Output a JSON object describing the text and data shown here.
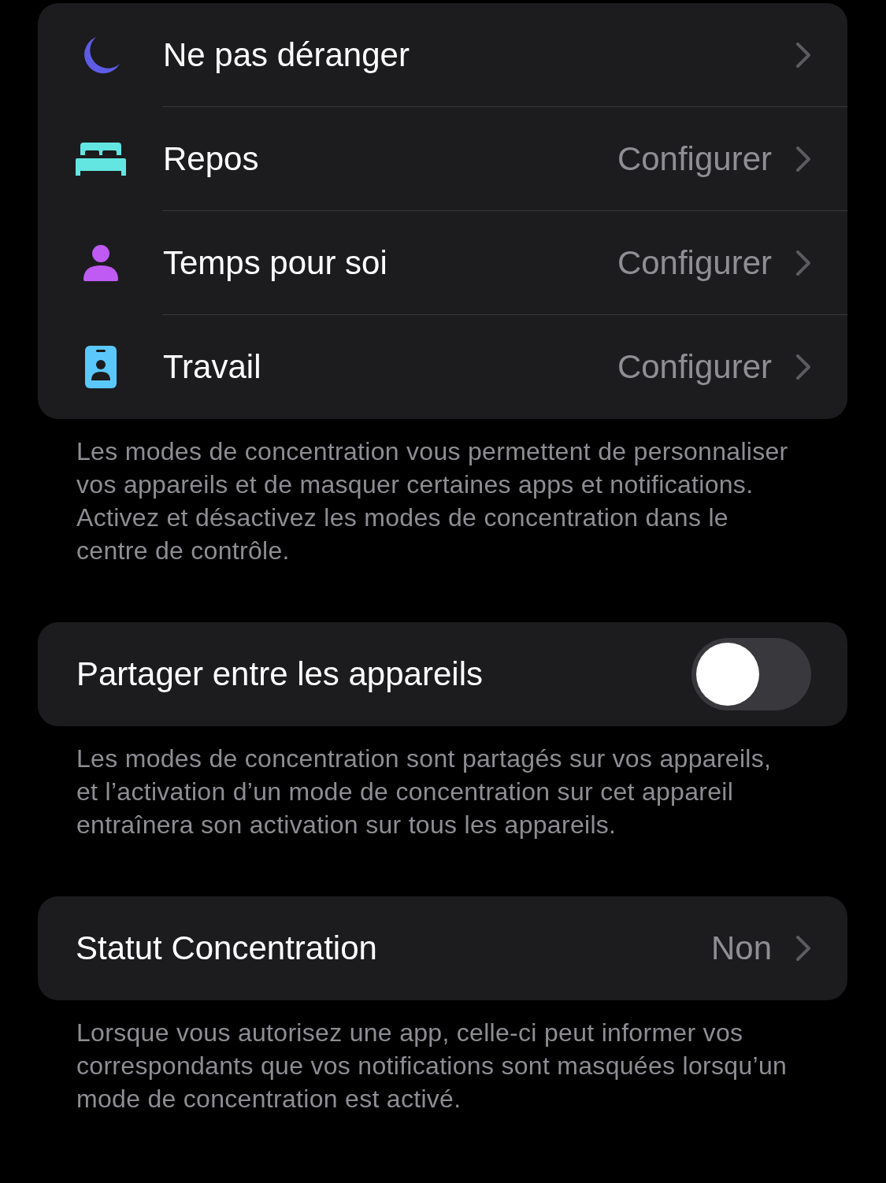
{
  "focus_modes": [
    {
      "label": "Ne pas déranger"
    },
    {
      "label": "Repos",
      "value": "Configurer"
    },
    {
      "label": "Temps pour soi",
      "value": "Configurer"
    },
    {
      "label": "Travail",
      "value": "Configurer"
    }
  ],
  "focus_modes_footer": "Les modes de concentration vous permettent de personnaliser vos appareils et de masquer certaines apps et notifications. Activez et désactivez les modes de concentration dans le centre de contrôle.",
  "share_across_devices": {
    "label": "Partager entre les appareils",
    "on": false
  },
  "share_footer": "Les modes de concentration sont partagés sur vos appareils, et l’activation d’un mode de concentration sur cet appareil entraînera son activation sur tous les appareils.",
  "focus_status": {
    "label": "Statut Concentration",
    "value": "Non"
  },
  "focus_status_footer": "Lorsque vous autorisez une app, celle-ci peut informer vos correspondants que vos notifications sont masquées lorsqu’un mode de concentration est activé."
}
